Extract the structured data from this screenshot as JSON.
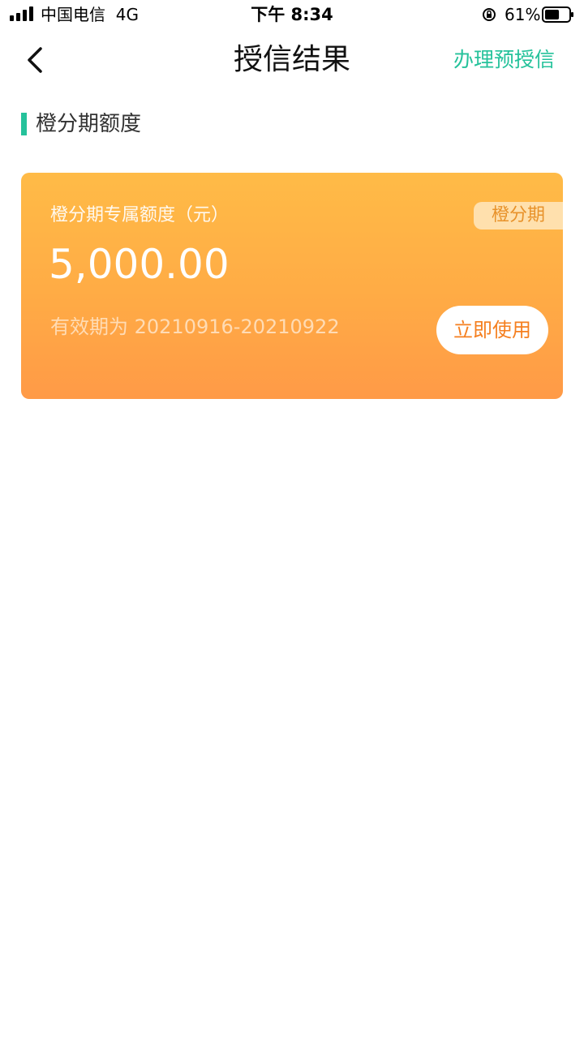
{
  "status_bar": {
    "carrier": "中国电信",
    "network": "4G",
    "time": "下午 8:34",
    "battery_percent": "61%",
    "battery_level": 0.61
  },
  "nav": {
    "back_icon": "chevron-left-icon",
    "title": "授信结果",
    "action_label": "办理预授信"
  },
  "section": {
    "title": "橙分期额度"
  },
  "credit_card": {
    "label": "橙分期专属额度（元）",
    "amount": "5,000.00",
    "validity": "有效期为  20210916-20210922",
    "tag": "橙分期",
    "button_label": "立即使用"
  },
  "colors": {
    "accent_green": "#25c29b",
    "card_orange_top": "#ffbb47",
    "card_orange_bottom": "#ff9a47",
    "button_text_orange": "#f57f1f"
  }
}
